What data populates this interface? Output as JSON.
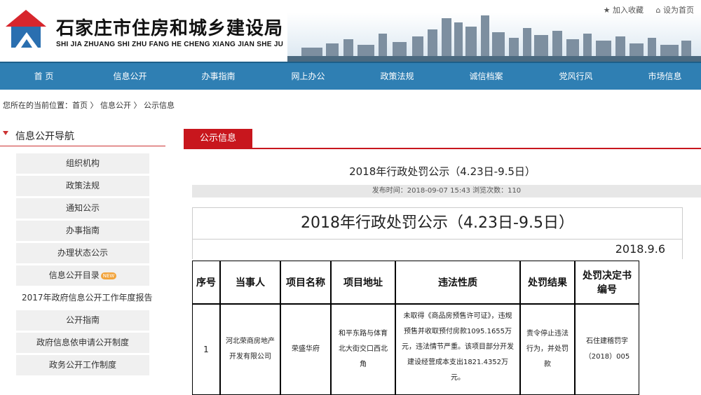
{
  "header": {
    "title": "石家庄市住房和城乡建设局",
    "pinyin": "SHI JIA ZHUANG SHI ZHU FANG HE CHENG XIANG JIAN SHE JU",
    "links": [
      "加入收藏",
      "设为首页"
    ],
    "link_icons": [
      "star-icon",
      "home-icon"
    ]
  },
  "nav": [
    "首 页",
    "信息公开",
    "办事指南",
    "网上办公",
    "政策法规",
    "诚信档案",
    "党风行风",
    "市场信息"
  ],
  "breadcrumb": {
    "prefix": "您所在的当前位置：",
    "items": [
      "首页",
      "信息公开",
      "公示信息"
    ],
    "sep": "〉"
  },
  "sidebar": {
    "title": "信息公开导航",
    "items": [
      "组织机构",
      "政策法规",
      "通知公示",
      "办事指南",
      "办理状态公示",
      "信息公开目录",
      "2017年政府信息公开工作年度报告",
      "公开指南",
      "政府信息依申请公开制度",
      "政务公开工作制度"
    ],
    "new_badge": "NEW"
  },
  "content": {
    "tab": "公示信息",
    "article_title": "2018年行政处罚公示（4.23日-9.5日）",
    "meta": "发布时间：2018-09-07 15:43     浏览次数：110",
    "table_title": "2018年行政处罚公示（4.23日-9.5日）",
    "table_date": "2018.9.6",
    "headers": [
      "序号",
      "当事人",
      "项目名称",
      "项目地址",
      "违法性质",
      "处罚结果",
      "处罚决定书编号"
    ],
    "row": {
      "no": "1",
      "party": "河北荣商房地产开发有限公司",
      "project": "荣盛华府",
      "address": "和平东路与体育北大街交口西北角",
      "nature": "未取得《商品房预售许可证》，违规预售并收取预付房款1095.1655万元，违法情节严重。该项目部分开发建设经营成本支出1821.4352万元。",
      "result": "责令停止违法行为，并处罚款",
      "decision": "石住建稽罚字（2018）005"
    }
  },
  "colors": {
    "nav": "#2f7fb3",
    "accent": "#c8161d"
  }
}
